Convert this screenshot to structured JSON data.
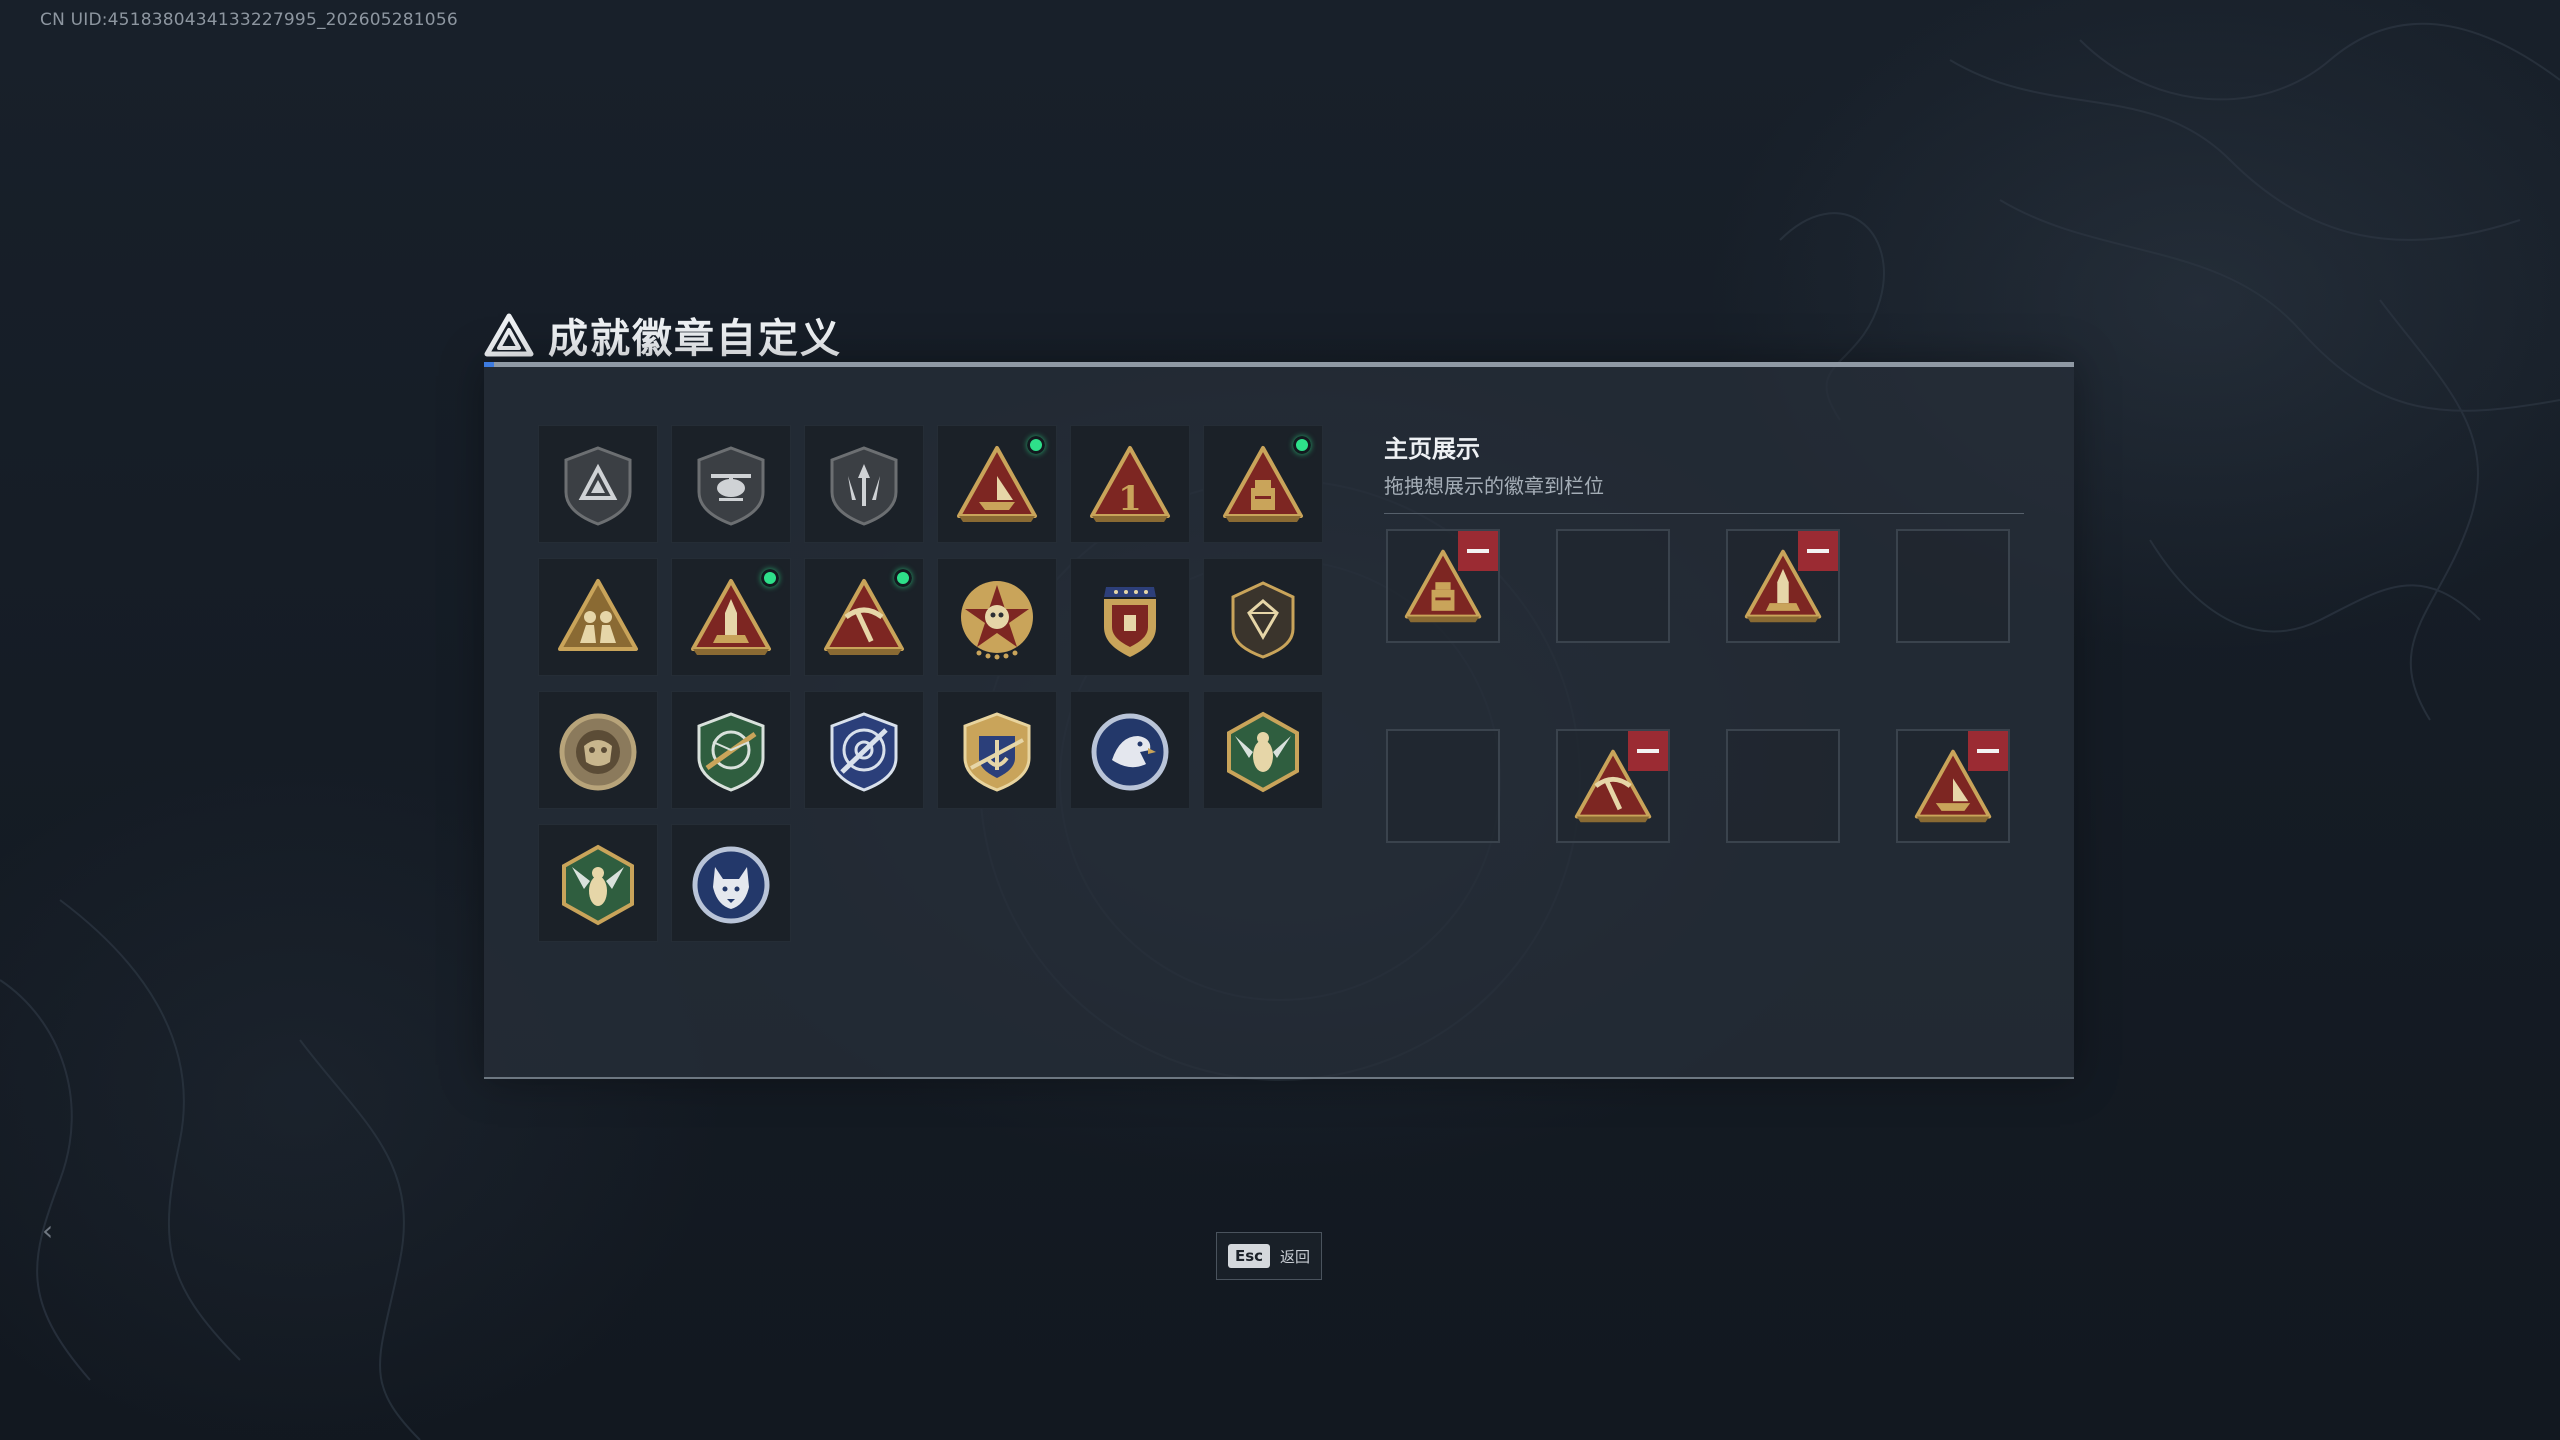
{
  "uid_text": "CN UID:4518380434133227995_202605281056",
  "title": "成就徽章自定义",
  "display": {
    "title": "主页展示",
    "subtitle": "拖拽想展示的徽章到栏位"
  },
  "footer": {
    "key": "Esc",
    "label": "返回"
  },
  "colors": {
    "new_dot": "#2ee08a",
    "remove": "#9b2b33",
    "gold": "#c9a45a",
    "red": "#8c2a26"
  },
  "badges": [
    {
      "icon": "dark-triangle-shield-badge-icon",
      "new": false
    },
    {
      "icon": "helicopter-shield-badge-icon",
      "new": false
    },
    {
      "icon": "arrow-shield-badge-icon",
      "new": false
    },
    {
      "icon": "boat-triangle-badge-icon",
      "new": true
    },
    {
      "icon": "number-one-triangle-badge-icon",
      "new": false
    },
    {
      "icon": "crate-triangle-badge-icon",
      "new": true
    },
    {
      "icon": "soldiers-triangle-badge-icon",
      "new": false
    },
    {
      "icon": "rocket-triangle-badge-icon",
      "new": true
    },
    {
      "icon": "pickaxe-triangle-badge-icon",
      "new": true
    },
    {
      "icon": "skull-star-medal-icon",
      "new": false
    },
    {
      "icon": "star-crest-shield-icon",
      "new": false
    },
    {
      "icon": "diamond-hex-badge-icon",
      "new": false
    },
    {
      "icon": "bronze-round-emblem-icon",
      "new": false
    },
    {
      "icon": "green-rifle-shield-icon",
      "new": false
    },
    {
      "icon": "blue-target-shield-icon",
      "new": false
    },
    {
      "icon": "gold-anchor-shield-icon",
      "new": false
    },
    {
      "icon": "eagle-round-badge-icon",
      "new": false
    },
    {
      "icon": "hornet-hex-badge-icon",
      "new": false
    },
    {
      "icon": "green-wasp-hex-badge-icon",
      "new": false
    },
    {
      "icon": "wolf-round-badge-icon",
      "new": false
    }
  ],
  "slots": [
    {
      "icon": "crate-triangle-badge-icon",
      "filled": true
    },
    {
      "icon": "",
      "filled": false
    },
    {
      "icon": "rocket-triangle-badge-icon",
      "filled": true
    },
    {
      "icon": "",
      "filled": false
    },
    {
      "icon": "",
      "filled": false
    },
    {
      "icon": "pickaxe-triangle-badge-icon",
      "filled": true
    },
    {
      "icon": "",
      "filled": false
    },
    {
      "icon": "boat-triangle-badge-icon",
      "filled": true
    }
  ]
}
